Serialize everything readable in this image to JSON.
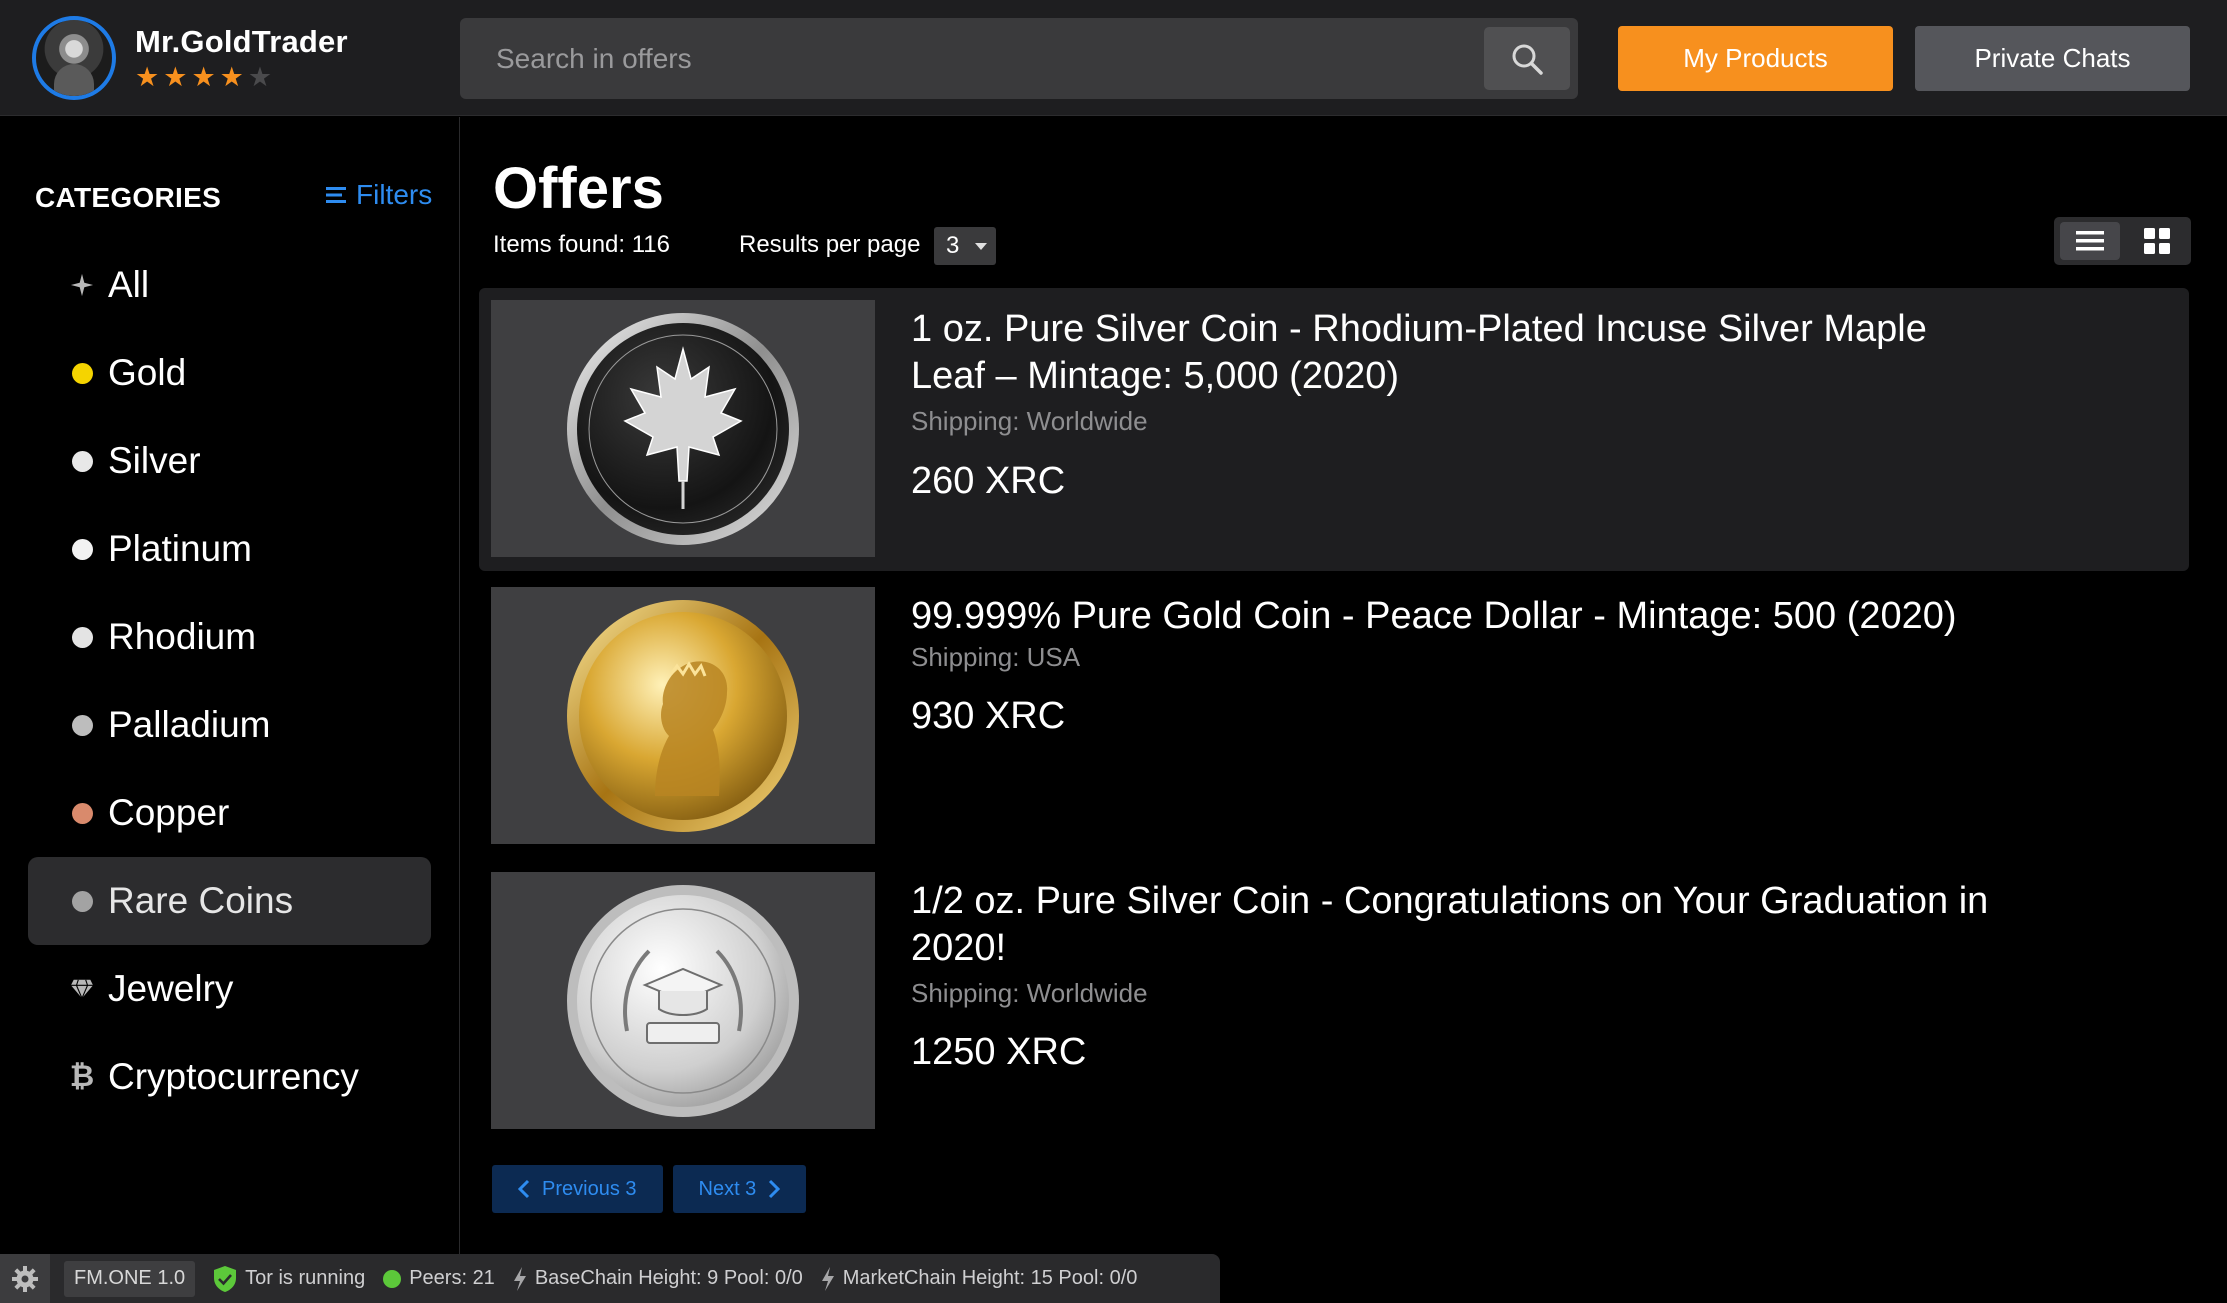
{
  "header": {
    "username": "Mr.GoldTrader",
    "rating": 4,
    "rating_max": 5,
    "search_placeholder": "Search in offers",
    "my_products_label": "My Products",
    "private_chats_label": "Private Chats"
  },
  "sidebar": {
    "title": "CATEGORIES",
    "filters_label": "Filters",
    "items": [
      {
        "label": "All",
        "icon": "sparkle-icon"
      },
      {
        "label": "Gold",
        "icon": "dot-icon",
        "color": "#f5d400"
      },
      {
        "label": "Silver",
        "icon": "dot-icon",
        "color": "#e8e8e8"
      },
      {
        "label": "Platinum",
        "icon": "dot-icon",
        "color": "#f2f2f2"
      },
      {
        "label": "Rhodium",
        "icon": "dot-icon",
        "color": "#e4e4e4"
      },
      {
        "label": "Palladium",
        "icon": "dot-icon",
        "color": "#bdbdbd"
      },
      {
        "label": "Copper",
        "icon": "dot-icon",
        "color": "#d98a6c"
      },
      {
        "label": "Rare Coins",
        "icon": "dot-icon",
        "color": "#a3a3a3",
        "active": true
      },
      {
        "label": "Jewelry",
        "icon": "diamond-icon"
      },
      {
        "label": "Cryptocurrency",
        "icon": "bitcoin-icon"
      }
    ]
  },
  "main": {
    "title": "Offers",
    "items_found": "Items found: 116",
    "results_per_page_label": "Results per page",
    "results_per_page_value": "3",
    "offers": [
      {
        "title": "1 oz. Pure Silver Coin - Rhodium-Plated Incuse Silver Maple Leaf – Mintage: 5,000 (2020)",
        "shipping": "Shipping: Worldwide",
        "price": "260 XRC",
        "image": "silver-maple-leaf-coin"
      },
      {
        "title": "99.999% Pure Gold Coin - Peace Dollar - Mintage: 500 (2020)",
        "shipping": "Shipping: USA",
        "price": "930 XRC",
        "image": "gold-peace-dollar-coin"
      },
      {
        "title": "1/2 oz. Pure Silver Coin - Congratulations on Your Graduation in 2020!",
        "shipping": "Shipping: Worldwide",
        "price": "1250 XRC",
        "image": "silver-graduation-coin"
      }
    ],
    "pager": {
      "previous_label": "Previous 3",
      "next_label": "Next 3"
    }
  },
  "statusbar": {
    "version": "FM.ONE 1.0",
    "tor": "Tor is running",
    "peers": "Peers: 21",
    "basechain": "BaseChain Height: 9 Pool: 0/0",
    "marketchain": "MarketChain Height: 15 Pool: 0/0"
  },
  "colors": {
    "accent_orange": "#f7901e",
    "accent_blue": "#2e8cf0",
    "avatar_ring": "#1e7be6",
    "tor_green": "#5cc83a"
  }
}
